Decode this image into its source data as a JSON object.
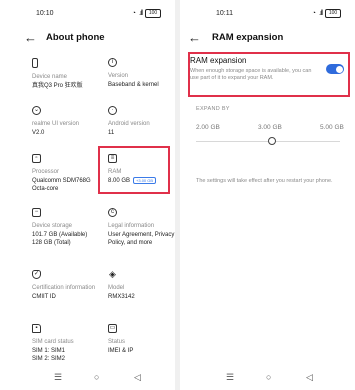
{
  "left": {
    "status": {
      "time": "10:10",
      "battery": "100"
    },
    "title": "About phone",
    "items": [
      {
        "icon": "phone-icon",
        "label": "Device name",
        "value": "真我Q3 Pro 狂欢版"
      },
      {
        "icon": "info-icon",
        "label": "Version",
        "value": "Baseband & kernel"
      },
      {
        "icon": "realme-ui-icon",
        "label": "realme UI version",
        "value": "V2.0"
      },
      {
        "icon": "android-icon",
        "label": "Android version",
        "value": "11"
      },
      {
        "icon": "processor-icon",
        "label": "Processor",
        "value": "Qualcomm SDM768G Octa-core"
      },
      {
        "icon": "ram-icon",
        "label": "RAM",
        "value": "8.00 GB",
        "badge": "+3.00 GB"
      },
      {
        "icon": "storage-icon",
        "label": "Device storage",
        "value": "101.7 GB (Available)\n128 GB (Total)"
      },
      {
        "icon": "copyright-icon",
        "label": "Legal information",
        "value": "User Agreement, Privacy Policy, and more"
      },
      {
        "icon": "certification-icon",
        "label": "Certification information",
        "value": "CMIIT ID"
      },
      {
        "icon": "layers-icon",
        "label": "Model",
        "value": "RMX3142"
      },
      {
        "icon": "sim-icon",
        "label": "SIM card status",
        "value": "SIM 1: SIM1\nSIM 2: SIM2"
      },
      {
        "icon": "status-icon",
        "label": "Status",
        "value": "IMEI & IP"
      }
    ]
  },
  "right": {
    "status": {
      "time": "10:11",
      "battery": "100"
    },
    "title": "RAM expansion",
    "setting": {
      "title": "RAM expansion",
      "description": "When enough storage space is available, you can use part of it to expand your RAM.",
      "enabled": true
    },
    "expand_by_label": "EXPAND BY",
    "options": [
      "2.00 GB",
      "3.00 GB",
      "5.00 GB"
    ],
    "selected_option": "3.00 GB",
    "note": "The settings will take effect after you restart your phone."
  },
  "navbar": {
    "menu": "☰",
    "home": "○",
    "back": "◁"
  },
  "colors": {
    "highlight": "#e0304a",
    "accent": "#2f6bdc"
  }
}
